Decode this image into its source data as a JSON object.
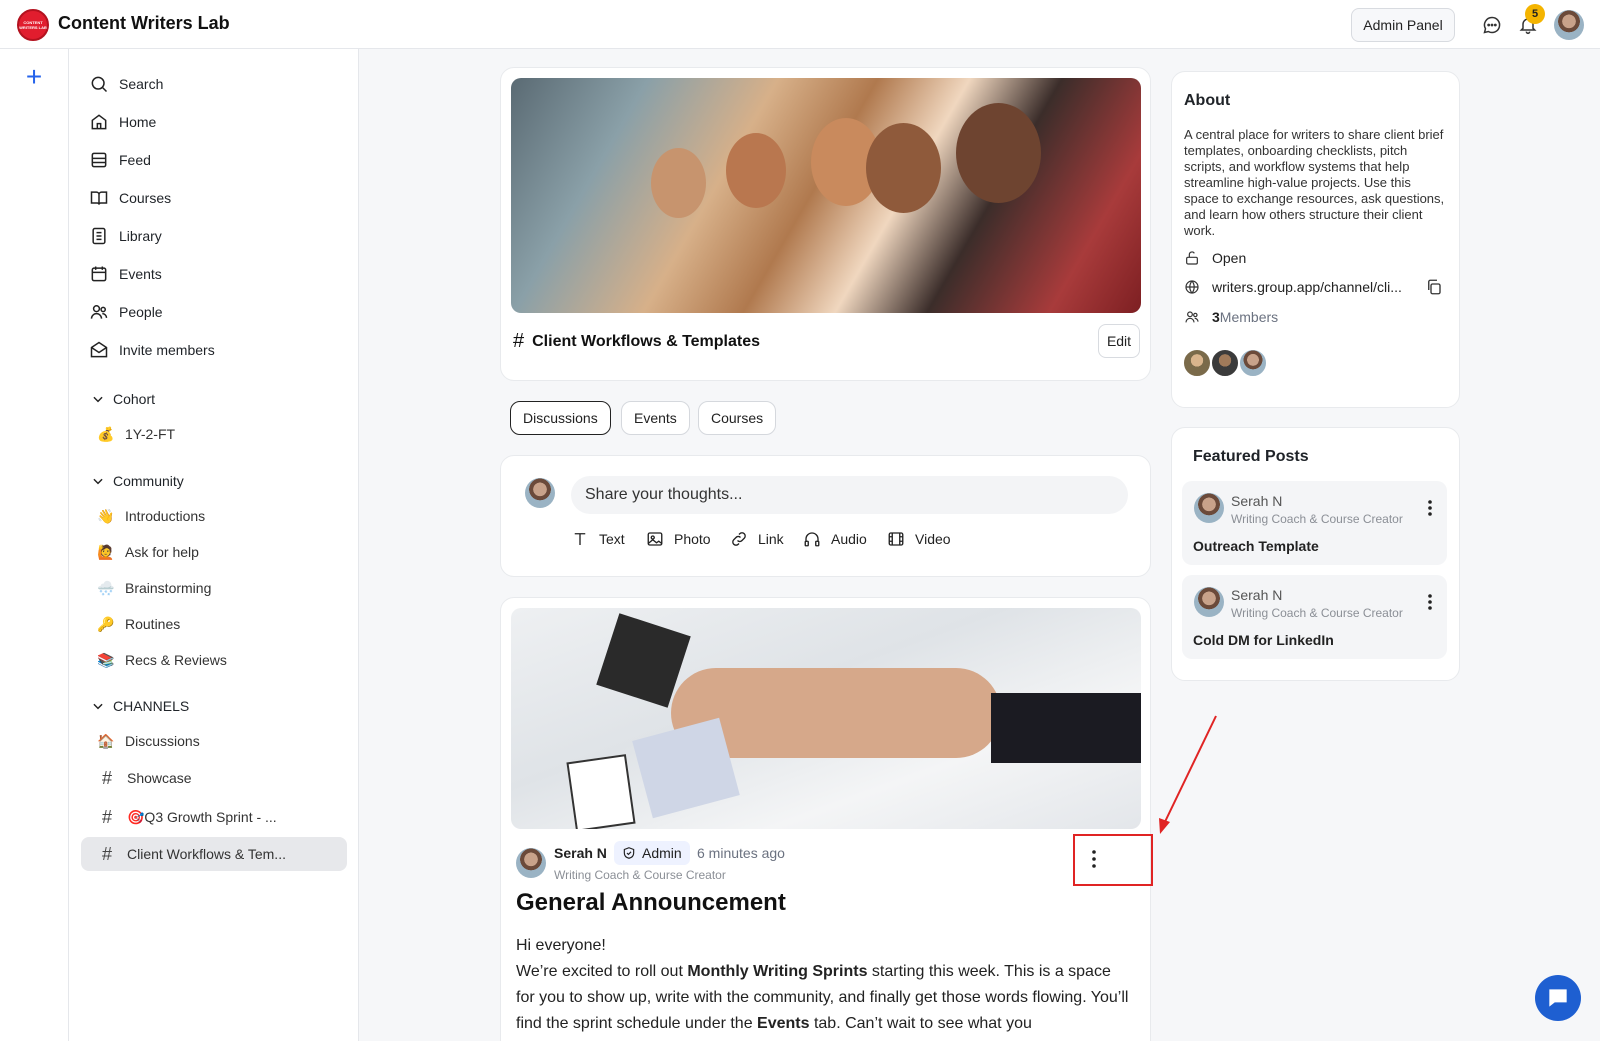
{
  "app": {
    "title": "Content Writers Lab",
    "logo_text": "CONTENT WRITERS LAB"
  },
  "topbar": {
    "admin_panel": "Admin Panel",
    "notification_count": "5"
  },
  "nav": [
    {
      "label": "Search",
      "icon": "search-icon"
    },
    {
      "label": "Home",
      "icon": "home-icon"
    },
    {
      "label": "Feed",
      "icon": "feed-icon"
    },
    {
      "label": "Courses",
      "icon": "book-icon"
    },
    {
      "label": "Library",
      "icon": "library-icon"
    },
    {
      "label": "Events",
      "icon": "calendar-icon"
    },
    {
      "label": "People",
      "icon": "people-icon"
    },
    {
      "label": "Invite members",
      "icon": "envelope-icon"
    }
  ],
  "sections": {
    "cohort": {
      "title": "Cohort",
      "items": [
        {
          "emoji": "💰",
          "label": "1Y-2-FT"
        }
      ]
    },
    "community": {
      "title": "Community",
      "items": [
        {
          "emoji": "👋",
          "label": "Introductions"
        },
        {
          "emoji": "🙋",
          "label": "Ask for help"
        },
        {
          "emoji": "🌨️",
          "label": "Brainstorming"
        },
        {
          "emoji": "🔑",
          "label": "Routines"
        },
        {
          "emoji": "📚",
          "label": "Recs & Reviews"
        }
      ]
    },
    "channels": {
      "title": "CHANNELS",
      "items": [
        {
          "prefix": "🏠",
          "label": "Discussions"
        },
        {
          "prefix": "#",
          "label": "Showcase"
        },
        {
          "prefix": "#",
          "label": "🎯Q3 Growth Sprint - ..."
        },
        {
          "prefix": "#",
          "label": "Client Workflows & Tem..."
        }
      ]
    }
  },
  "channel": {
    "title": "Client Workflows & Templates",
    "edit_label": "Edit"
  },
  "tabs": [
    "Discussions",
    "Events",
    "Courses"
  ],
  "composer": {
    "placeholder": "Share your thoughts...",
    "actions": [
      "Text",
      "Photo",
      "Link",
      "Audio",
      "Video"
    ]
  },
  "post": {
    "author": "Serah N",
    "badge": "Admin",
    "time": "6 minutes ago",
    "role": "Writing Coach & Course Creator",
    "title": "General Announcement",
    "greeting": "Hi everyone!",
    "p1_a": "We’re excited to roll out ",
    "p1_bold": "Monthly Writing Sprints",
    "p1_b": " starting this week. This is a space for you to show up, write with the community, and finally get those words flowing. You’ll find the sprint schedule under the ",
    "p1_bold2": "Events",
    "p1_c": " tab. Can’t wait to see what you"
  },
  "about": {
    "title": "About",
    "description": "A central place for writers to share client brief templates, onboarding checklists, pitch scripts, and workflow systems that help streamline high-value projects. Use this space to exchange resources, ask questions, and learn how others structure their client work.",
    "privacy": "Open",
    "link": "writers.group.app/channel/cli...",
    "members_count": "3",
    "members_label": " Members"
  },
  "featured": {
    "title": "Featured Posts",
    "items": [
      {
        "author": "Serah N",
        "role": "Writing Coach & Course Creator",
        "post": "Outreach Template"
      },
      {
        "author": "Serah N",
        "role": "Writing Coach & Course Creator",
        "post": "Cold DM for LinkedIn"
      }
    ]
  },
  "colors": {
    "accent": "#2563eb",
    "highlight": "#e02424",
    "fab": "#1e5fd1"
  }
}
